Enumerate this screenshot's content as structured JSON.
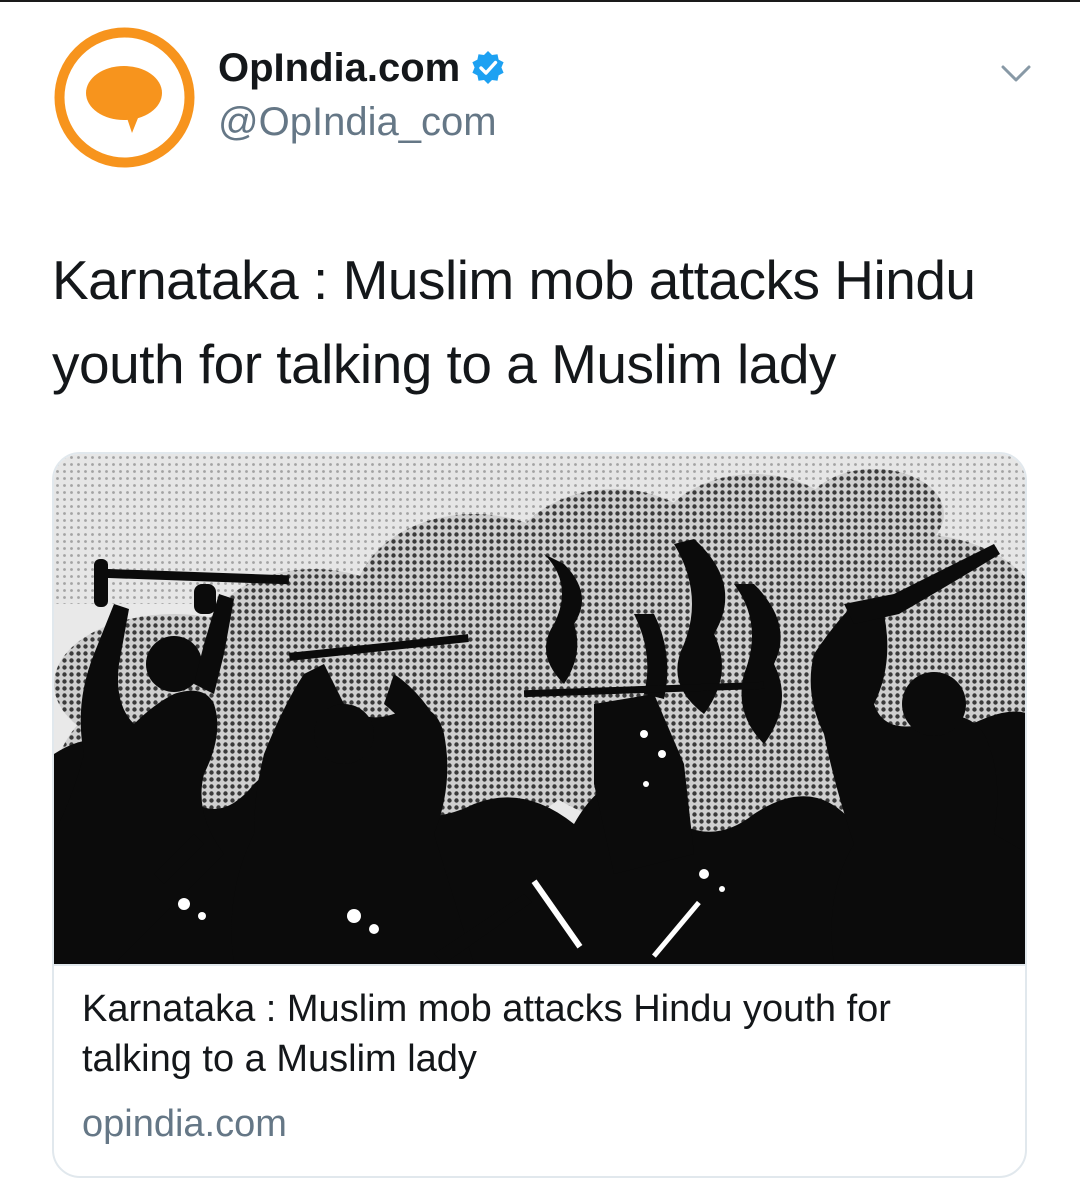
{
  "author": {
    "display_name": "OpIndia.com",
    "handle": "@OpIndia_com",
    "verified": true,
    "avatar_icon": "speech-bubble-icon",
    "avatar_color": "#f7941d"
  },
  "menu": {
    "icon": "chevron-down-icon"
  },
  "tweet": {
    "text": "Karnataka : Muslim mob attacks Hindu youth for talking to a Muslim lady"
  },
  "link_card": {
    "title": "Karnataka : Muslim mob attacks Hindu youth for talking to a Muslim lady",
    "domain": "opindia.com",
    "image_description_icon": "mob-silhouette-illustration"
  },
  "colors": {
    "verified_blue": "#1da1f2",
    "text_primary": "#14171a",
    "text_secondary": "#657786",
    "border": "#e1e8ed"
  }
}
